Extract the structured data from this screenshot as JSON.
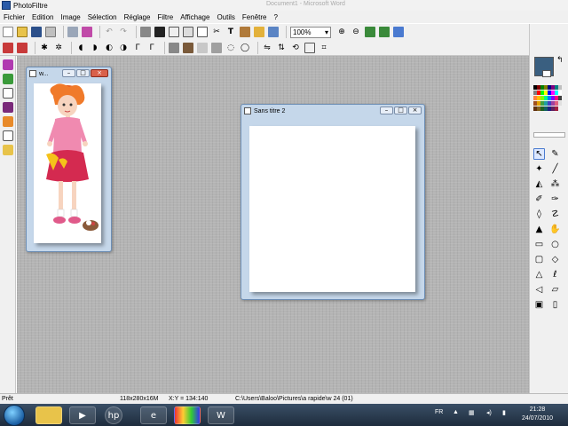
{
  "app": {
    "title": "PhotoFiltre",
    "ghost_title": "Document1 - Microsoft Word"
  },
  "menu": [
    "Fichier",
    "Edition",
    "Image",
    "Sélection",
    "Réglage",
    "Filtre",
    "Affichage",
    "Outils",
    "Fenêtre",
    "?"
  ],
  "toolbar": {
    "zoom_value": "100%"
  },
  "colors": {
    "foreground": "#3a5f80",
    "background": "#ffffff",
    "workspace": "#b4b4b4"
  },
  "doc1": {
    "title": "w...",
    "minimize": "–",
    "maximize": "□",
    "close": "×"
  },
  "doc2": {
    "title": "Sans titre 2",
    "minimize": "–",
    "maximize": "□",
    "close": "×"
  },
  "status": {
    "state": "Prêt",
    "dimensions": "118x280x16M",
    "coords": "X:Y = 134:140",
    "path": "C:\\Users\\Baloo\\Pictures\\a rapide\\w 24 (01)"
  },
  "taskbar": {
    "lang": "FR",
    "time": "21:28",
    "date": "24/07/2010"
  }
}
